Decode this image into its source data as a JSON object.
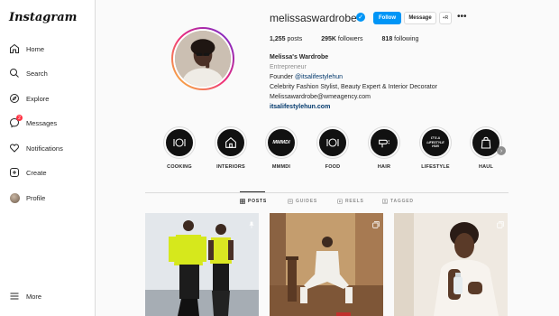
{
  "sidebar": {
    "logo": "Instagram",
    "items": [
      {
        "label": "Home",
        "icon": "home-icon"
      },
      {
        "label": "Search",
        "icon": "search-icon"
      },
      {
        "label": "Explore",
        "icon": "compass-icon"
      },
      {
        "label": "Messages",
        "icon": "messenger-icon",
        "badge": "2"
      },
      {
        "label": "Notifications",
        "icon": "heart-icon"
      },
      {
        "label": "Create",
        "icon": "plus-square-icon"
      },
      {
        "label": "Profile",
        "icon": "avatar"
      }
    ],
    "more": "More"
  },
  "profile": {
    "username": "melissaswardrobe",
    "verified": true,
    "follow_label": "Follow",
    "message_label": "Message",
    "suggest_label": "+R",
    "stats": {
      "posts_count": "1,255",
      "posts_label": "posts",
      "followers_count": "295K",
      "followers_label": "followers",
      "following_count": "818",
      "following_label": "following"
    },
    "bio": {
      "name": "Melissa's Wardrobe",
      "category": "Entrepreneur",
      "line1_prefix": "Founder ",
      "line1_link": "@itsalifestylehun",
      "line2": "Celebrity Fashion Stylist, Beauty Expert & Interior Decorator",
      "line3": "Melissawardrobe@wmeagency.com",
      "website": "itsalifestylehun.com"
    }
  },
  "highlights": [
    {
      "label": "COOKING",
      "icon": "plate-icon"
    },
    {
      "label": "INTERIORS",
      "icon": "house-icon"
    },
    {
      "label": "MMMDI",
      "icon": "text-mmmdi",
      "text": "MMMDI"
    },
    {
      "label": "FOOD",
      "icon": "plate-icon"
    },
    {
      "label": "HAIR",
      "icon": "hairdryer-icon"
    },
    {
      "label": "LIFESTYLE",
      "icon": "text-lifestyle",
      "text": "IT'S A LIFESTYLE HUN"
    },
    {
      "label": "HAUL",
      "icon": "shopping-bag-icon"
    }
  ],
  "tabs": [
    {
      "label": "POSTS",
      "active": true
    },
    {
      "label": "GUIDES",
      "active": false
    },
    {
      "label": "REELS",
      "active": false
    },
    {
      "label": "TAGGED",
      "active": false
    }
  ],
  "colors": {
    "accent": "#0095f6",
    "badge": "#ff3040",
    "text": "#262626",
    "muted": "#8e8e8e"
  }
}
